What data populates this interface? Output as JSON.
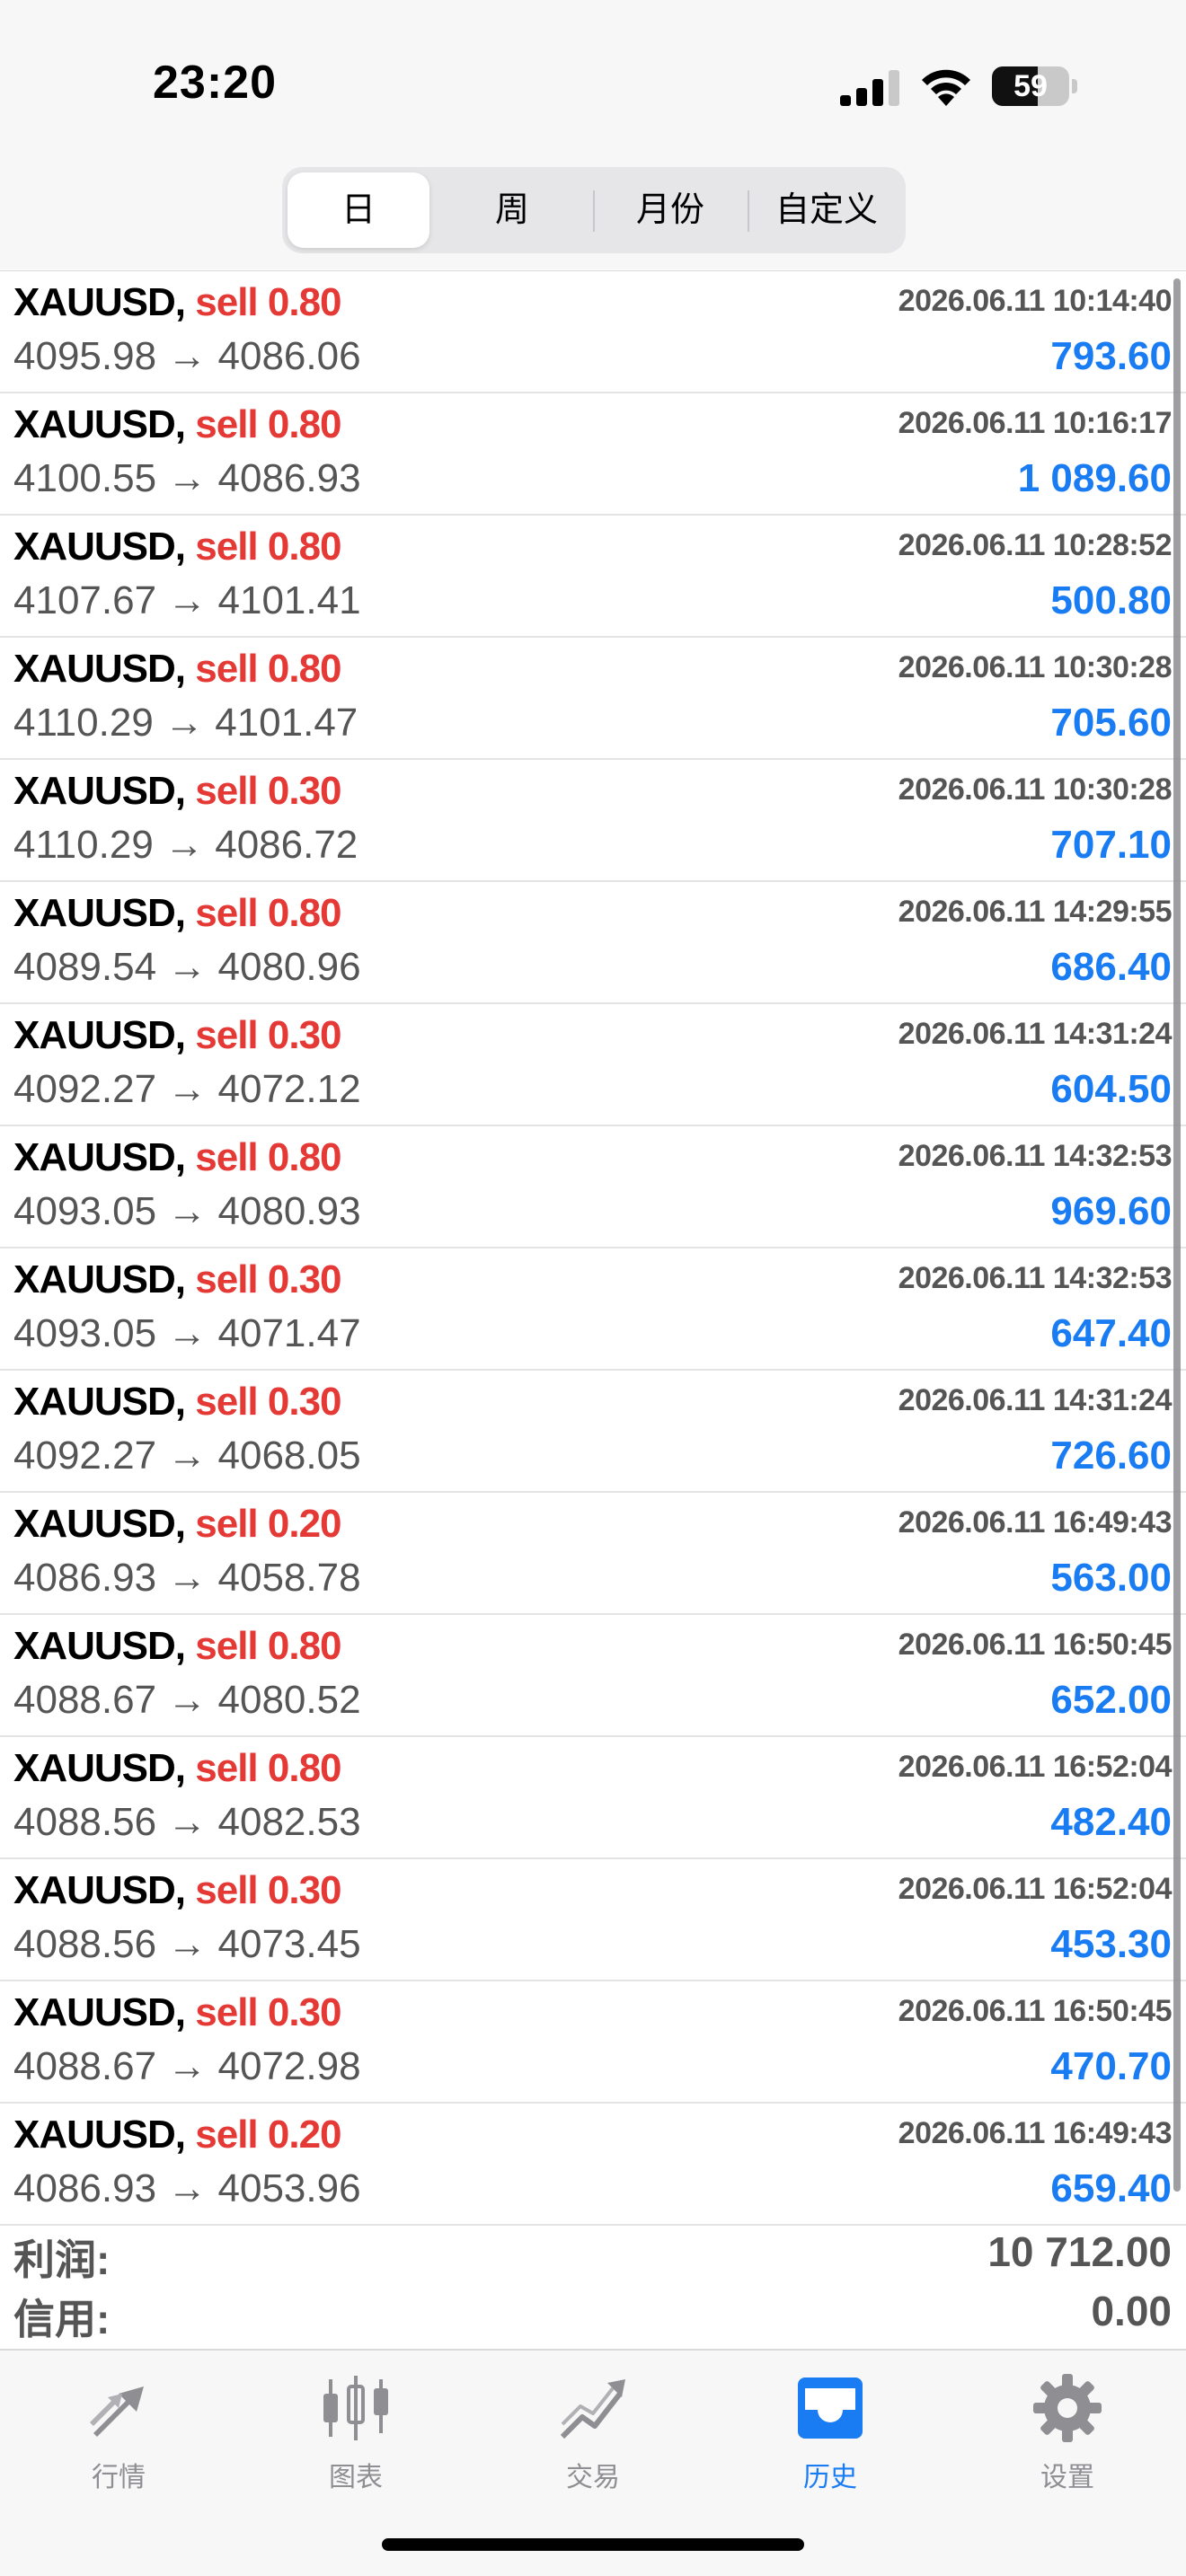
{
  "status_bar": {
    "time": "23:20",
    "battery": "59",
    "battery_level": 0.59
  },
  "segments": [
    {
      "label": "日",
      "active": true
    },
    {
      "label": "周",
      "active": false
    },
    {
      "label": "月份",
      "active": false
    },
    {
      "label": "自定义",
      "active": false
    }
  ],
  "trades": [
    {
      "symbol": "XAUUSD,",
      "side": "sell 0.80",
      "prices": "4095.98 → 4086.06",
      "datetime": "2026.06.11 10:14:40",
      "profit": "793.60"
    },
    {
      "symbol": "XAUUSD,",
      "side": "sell 0.80",
      "prices": "4100.55 → 4086.93",
      "datetime": "2026.06.11 10:16:17",
      "profit": "1 089.60"
    },
    {
      "symbol": "XAUUSD,",
      "side": "sell 0.80",
      "prices": "4107.67 → 4101.41",
      "datetime": "2026.06.11 10:28:52",
      "profit": "500.80"
    },
    {
      "symbol": "XAUUSD,",
      "side": "sell 0.80",
      "prices": "4110.29 → 4101.47",
      "datetime": "2026.06.11 10:30:28",
      "profit": "705.60"
    },
    {
      "symbol": "XAUUSD,",
      "side": "sell 0.30",
      "prices": "4110.29 → 4086.72",
      "datetime": "2026.06.11 10:30:28",
      "profit": "707.10"
    },
    {
      "symbol": "XAUUSD,",
      "side": "sell 0.80",
      "prices": "4089.54 → 4080.96",
      "datetime": "2026.06.11 14:29:55",
      "profit": "686.40"
    },
    {
      "symbol": "XAUUSD,",
      "side": "sell 0.30",
      "prices": "4092.27 → 4072.12",
      "datetime": "2026.06.11 14:31:24",
      "profit": "604.50"
    },
    {
      "symbol": "XAUUSD,",
      "side": "sell 0.80",
      "prices": "4093.05 → 4080.93",
      "datetime": "2026.06.11 14:32:53",
      "profit": "969.60"
    },
    {
      "symbol": "XAUUSD,",
      "side": "sell 0.30",
      "prices": "4093.05 → 4071.47",
      "datetime": "2026.06.11 14:32:53",
      "profit": "647.40"
    },
    {
      "symbol": "XAUUSD,",
      "side": "sell 0.30",
      "prices": "4092.27 → 4068.05",
      "datetime": "2026.06.11 14:31:24",
      "profit": "726.60"
    },
    {
      "symbol": "XAUUSD,",
      "side": "sell 0.20",
      "prices": "4086.93 → 4058.78",
      "datetime": "2026.06.11 16:49:43",
      "profit": "563.00"
    },
    {
      "symbol": "XAUUSD,",
      "side": "sell 0.80",
      "prices": "4088.67 → 4080.52",
      "datetime": "2026.06.11 16:50:45",
      "profit": "652.00"
    },
    {
      "symbol": "XAUUSD,",
      "side": "sell 0.80",
      "prices": "4088.56 → 4082.53",
      "datetime": "2026.06.11 16:52:04",
      "profit": "482.40"
    },
    {
      "symbol": "XAUUSD,",
      "side": "sell 0.30",
      "prices": "4088.56 → 4073.45",
      "datetime": "2026.06.11 16:52:04",
      "profit": "453.30"
    },
    {
      "symbol": "XAUUSD,",
      "side": "sell 0.30",
      "prices": "4088.67 → 4072.98",
      "datetime": "2026.06.11 16:50:45",
      "profit": "470.70"
    },
    {
      "symbol": "XAUUSD,",
      "side": "sell 0.20",
      "prices": "4086.93 → 4053.96",
      "datetime": "2026.06.11 16:49:43",
      "profit": "659.40"
    }
  ],
  "summary": {
    "profit_label": "利润:",
    "profit_value": "10 712.00",
    "credit_label": "信用:",
    "credit_value": "0.00"
  },
  "tabbar": [
    {
      "label": "行情",
      "icon": "quotes-arrows-icon",
      "active": false
    },
    {
      "label": "图表",
      "icon": "candlestick-chart-icon",
      "active": false
    },
    {
      "label": "交易",
      "icon": "trade-trend-icon",
      "active": false
    },
    {
      "label": "历史",
      "icon": "history-inbox-icon",
      "active": true
    },
    {
      "label": "设置",
      "icon": "gear-icon",
      "active": false
    }
  ],
  "colors": {
    "accent": "#1a7cf2",
    "sell": "#e53935",
    "inactive": "#8e8e93"
  }
}
